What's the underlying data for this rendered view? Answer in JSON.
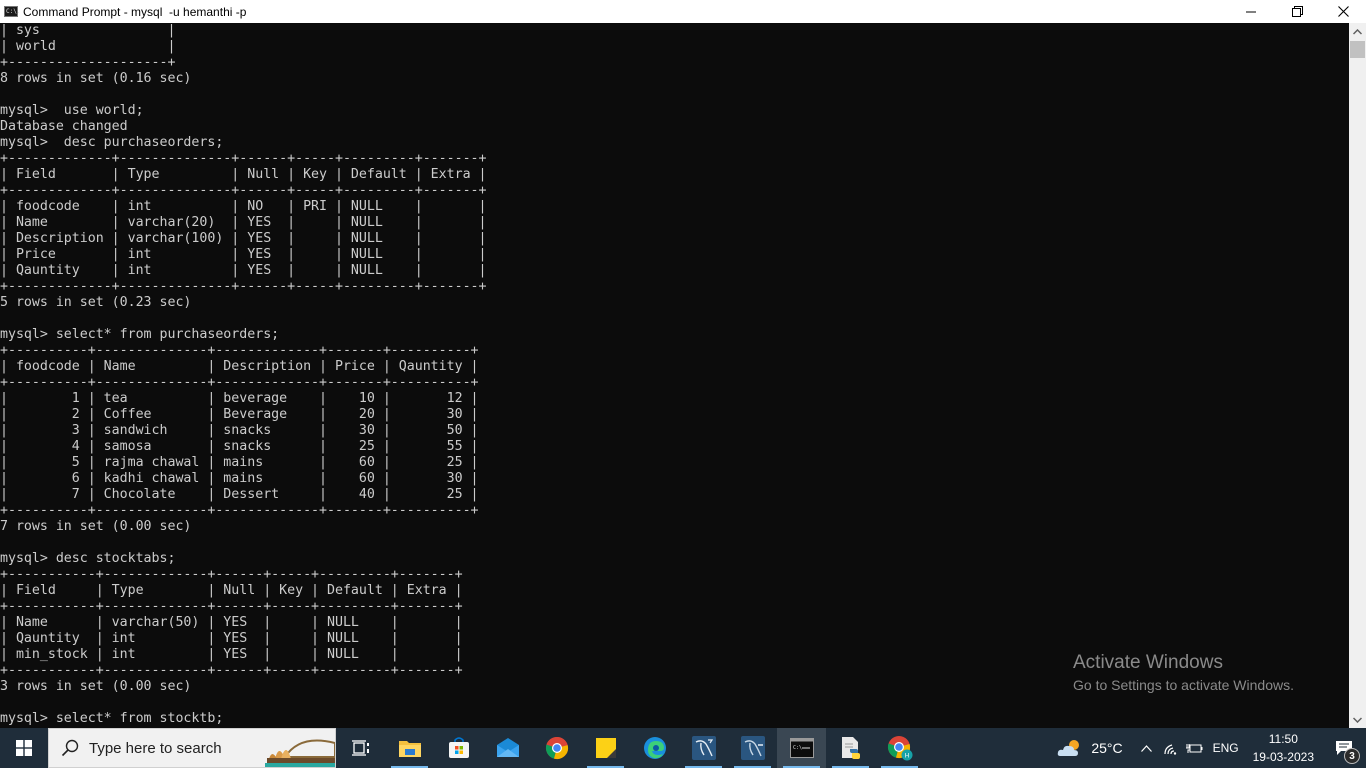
{
  "window": {
    "title": "Command Prompt - mysql  -u hemanthi -p",
    "icon": "cmd-icon",
    "icon_text": "C:\\.",
    "controls": [
      "minimize-icon",
      "restore-icon",
      "close-icon"
    ]
  },
  "console": {
    "lines": [
      "| sys                |",
      "| world              |",
      "+--------------------+",
      "8 rows in set (0.16 sec)",
      "",
      "mysql>  use world;",
      "Database changed",
      "mysql>  desc purchaseorders;",
      "+-------------+--------------+------+-----+---------+-------+",
      "| Field       | Type         | Null | Key | Default | Extra |",
      "+-------------+--------------+------+-----+---------+-------+",
      "| foodcode    | int          | NO   | PRI | NULL    |       |",
      "| Name        | varchar(20)  | YES  |     | NULL    |       |",
      "| Description | varchar(100) | YES  |     | NULL    |       |",
      "| Price       | int          | YES  |     | NULL    |       |",
      "| Qauntity    | int          | YES  |     | NULL    |       |",
      "+-------------+--------------+------+-----+---------+-------+",
      "5 rows in set (0.23 sec)",
      "",
      "mysql> select* from purchaseorders;",
      "+----------+--------------+-------------+-------+----------+",
      "| foodcode | Name         | Description | Price | Qauntity |",
      "+----------+--------------+-------------+-------+----------+",
      "|        1 | tea          | beverage    |    10 |       12 |",
      "|        2 | Coffee       | Beverage    |    20 |       30 |",
      "|        3 | sandwich     | snacks      |    30 |       50 |",
      "|        4 | samosa       | snacks      |    25 |       55 |",
      "|        5 | rajma chawal | mains       |    60 |       25 |",
      "|        6 | kadhi chawal | mains       |    60 |       30 |",
      "|        7 | Chocolate    | Dessert     |    40 |       25 |",
      "+----------+--------------+-------------+-------+----------+",
      "7 rows in set (0.00 sec)",
      "",
      "mysql> desc stocktabs;",
      "+-----------+-------------+------+-----+---------+-------+",
      "| Field     | Type        | Null | Key | Default | Extra |",
      "+-----------+-------------+------+-----+---------+-------+",
      "| Name      | varchar(50) | YES  |     | NULL    |       |",
      "| Qauntity  | int         | YES  |     | NULL    |       |",
      "| min_stock | int         | YES  |     | NULL    |       |",
      "+-----------+-------------+------+-----+---------+-------+",
      "3 rows in set (0.00 sec)",
      "",
      "mysql> select* from stocktb;"
    ],
    "tables": {
      "desc_purchaseorders": {
        "columns": [
          "Field",
          "Type",
          "Null",
          "Key",
          "Default",
          "Extra"
        ],
        "rows": [
          [
            "foodcode",
            "int",
            "NO",
            "PRI",
            "NULL",
            ""
          ],
          [
            "Name",
            "varchar(20)",
            "YES",
            "",
            "NULL",
            ""
          ],
          [
            "Description",
            "varchar(100)",
            "YES",
            "",
            "NULL",
            ""
          ],
          [
            "Price",
            "int",
            "YES",
            "",
            "NULL",
            ""
          ],
          [
            "Qauntity",
            "int",
            "YES",
            "",
            "NULL",
            ""
          ]
        ]
      },
      "purchaseorders": {
        "columns": [
          "foodcode",
          "Name",
          "Description",
          "Price",
          "Qauntity"
        ],
        "rows": [
          [
            1,
            "tea",
            "beverage",
            10,
            12
          ],
          [
            2,
            "Coffee",
            "Beverage",
            20,
            30
          ],
          [
            3,
            "sandwich",
            "snacks",
            30,
            50
          ],
          [
            4,
            "samosa",
            "snacks",
            25,
            55
          ],
          [
            5,
            "rajma chawal",
            "mains",
            60,
            25
          ],
          [
            6,
            "kadhi chawal",
            "mains",
            60,
            30
          ],
          [
            7,
            "Chocolate",
            "Dessert",
            40,
            25
          ]
        ]
      },
      "desc_stocktabs": {
        "columns": [
          "Field",
          "Type",
          "Null",
          "Key",
          "Default",
          "Extra"
        ],
        "rows": [
          [
            "Name",
            "varchar(50)",
            "YES",
            "",
            "NULL",
            ""
          ],
          [
            "Qauntity",
            "int",
            "YES",
            "",
            "NULL",
            ""
          ],
          [
            "min_stock",
            "int",
            "YES",
            "",
            "NULL",
            ""
          ]
        ]
      }
    },
    "text_color": "#cccccc",
    "background": "#0c0c0c"
  },
  "watermark": {
    "title": "Activate Windows",
    "subtitle": "Go to Settings to activate Windows."
  },
  "taskbar": {
    "search_placeholder": "Type here to search",
    "apps": [
      {
        "name": "task-view",
        "icon": "task-view-icon",
        "active": false
      },
      {
        "name": "file-explorer",
        "icon": "folder-icon",
        "active": true
      },
      {
        "name": "microsoft-store",
        "icon": "store-icon",
        "active": false
      },
      {
        "name": "mail",
        "icon": "mail-icon",
        "active": false
      },
      {
        "name": "chrome",
        "icon": "chrome-icon",
        "active": false
      },
      {
        "name": "sticky-notes",
        "icon": "sticky-notes-icon",
        "active": true
      },
      {
        "name": "edge",
        "icon": "edge-icon",
        "active": false
      },
      {
        "name": "mysql-workbench",
        "icon": "mysql-dolphin-icon",
        "active": true
      },
      {
        "name": "mysql-shell",
        "icon": "mysql-shell-icon",
        "active": true
      },
      {
        "name": "command-prompt",
        "icon": "cmd-icon",
        "active": true,
        "focused": true
      },
      {
        "name": "python-file",
        "icon": "python-file-icon",
        "active": true
      },
      {
        "name": "chrome-profile",
        "icon": "chrome-profile-icon",
        "active": true
      }
    ],
    "tray": {
      "weather": "25°C",
      "language": "ENG",
      "time": "11:50",
      "date": "19-03-2023",
      "notifications": "3"
    }
  }
}
